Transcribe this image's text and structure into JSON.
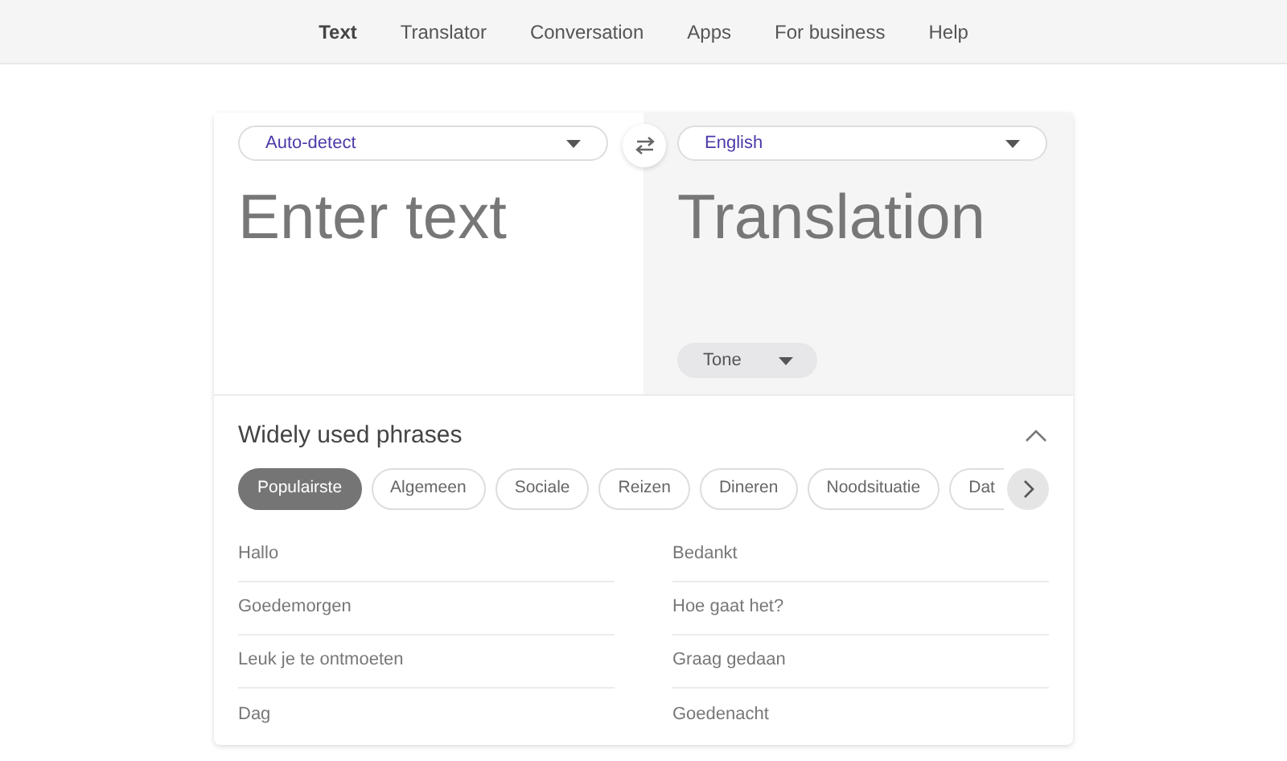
{
  "nav": [
    {
      "label": "Text",
      "selected": true
    },
    {
      "label": "Translator",
      "selected": false
    },
    {
      "label": "Conversation",
      "selected": false
    },
    {
      "label": "Apps",
      "selected": false
    },
    {
      "label": "For business",
      "selected": false
    },
    {
      "label": "Help",
      "selected": false
    }
  ],
  "source": {
    "language": "Auto-detect",
    "placeholder": "Enter text"
  },
  "target": {
    "language": "English",
    "placeholder": "Translation",
    "tone": "Tone"
  },
  "phrases": {
    "title": "Widely used phrases",
    "expanded": true,
    "categories": [
      {
        "label": "Populairste",
        "selected": true
      },
      {
        "label": "Algemeen",
        "selected": false
      },
      {
        "label": "Sociale",
        "selected": false
      },
      {
        "label": "Reizen",
        "selected": false
      },
      {
        "label": "Dineren",
        "selected": false
      },
      {
        "label": "Noodsituatie",
        "selected": false
      },
      {
        "label": "Dat",
        "selected": false
      }
    ],
    "columns": [
      [
        "Hallo",
        "Goedemorgen",
        "Leuk je te ontmoeten",
        "Dag"
      ],
      [
        "Bedankt",
        "Hoe gaat het?",
        "Graag gedaan",
        "Goedenacht"
      ]
    ]
  }
}
